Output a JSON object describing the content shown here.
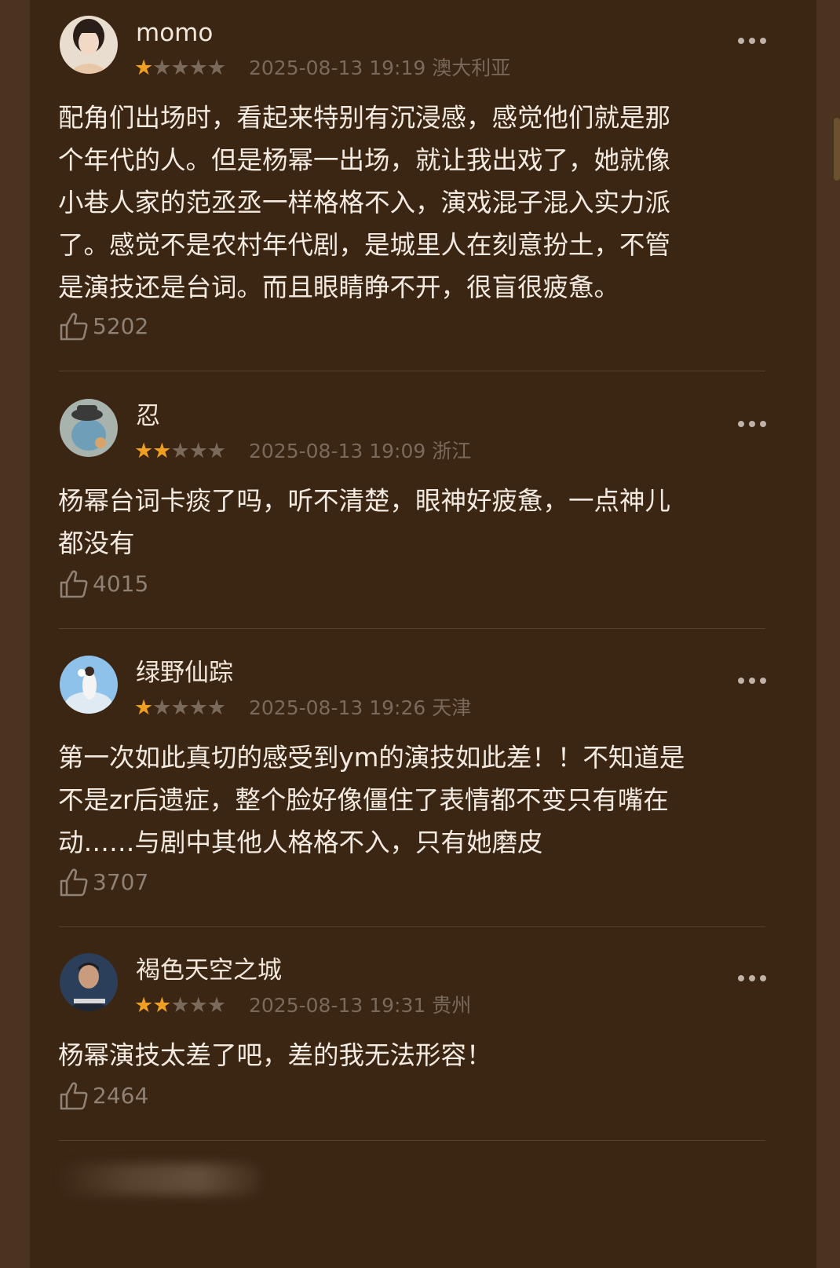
{
  "comments": [
    {
      "username": "momo",
      "rating": 1,
      "timestamp": "2025-08-13 19:19",
      "location": "澳大利亚",
      "text": "配角们出场时，看起来特别有沉浸感，感觉他们就是那\n个年代的人。但是杨幂一出场，就让我出戏了，她就像\n小巷人家的范丞丞一样格格不入，演戏混子混入实力派\n了。感觉不是农村年代剧，是城里人在刻意扮土，不管\n是演技还是台词。而且眼睛睁不开，很盲很疲惫。",
      "likes": "5202"
    },
    {
      "username": "忍",
      "rating": 2,
      "timestamp": "2025-08-13 19:09",
      "location": "浙江",
      "text": "杨幂台词卡痰了吗，听不清楚，眼神好疲惫，一点神儿\n都没有",
      "likes": "4015"
    },
    {
      "username": "绿野仙踪",
      "rating": 1,
      "timestamp": "2025-08-13 19:26",
      "location": "天津",
      "text": "第一次如此真切的感受到ym的演技如此差！！不知道是\n不是zr后遗症，整个脸好像僵住了表情都不变只有嘴在\n动……与剧中其他人格格不入，只有她磨皮",
      "likes": "3707"
    },
    {
      "username": "褐色天空之城",
      "rating": 2,
      "timestamp": "2025-08-13 19:31",
      "location": "贵州",
      "text": "杨幂演技太差了吧，差的我无法形容！",
      "likes": "2464"
    }
  ],
  "colors": {
    "background": "#3b2513",
    "star_active": "#f0a020",
    "star_inactive": "#7a6a5c",
    "text": "#f3ebe2"
  },
  "icons": {
    "like": "thumbs-up-icon",
    "more": "more-dots-icon",
    "star": "star-icon"
  }
}
